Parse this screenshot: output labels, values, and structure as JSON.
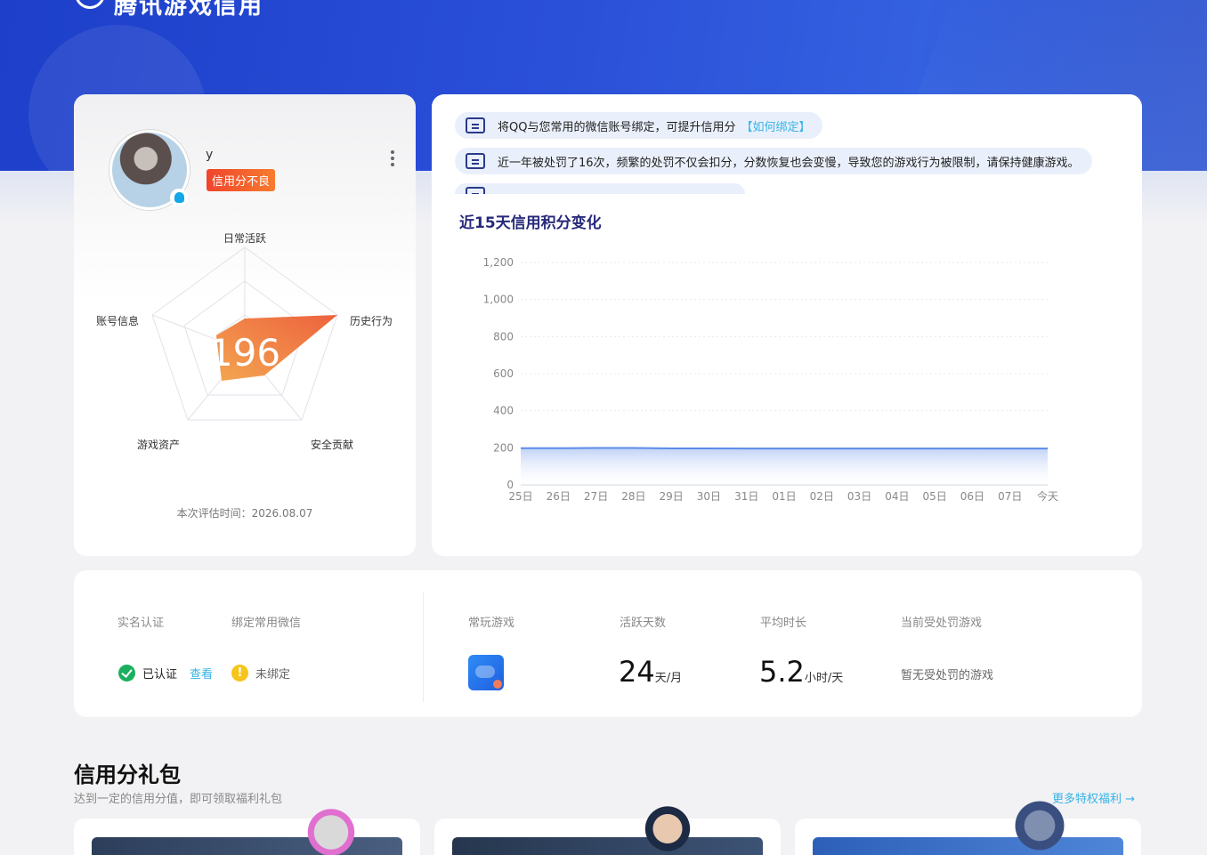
{
  "header": {
    "title": "腾讯游戏信用"
  },
  "profile": {
    "username": "y",
    "credit_status": "信用分不良",
    "score": "196",
    "radar_labels": [
      "日常活跃",
      "历史行为",
      "安全贡献",
      "游戏资产",
      "账号信息"
    ],
    "eval_time": "本次评估时间：2026.08.07"
  },
  "notices": [
    {
      "text": "将QQ与您常用的微信账号绑定，可提升信用分",
      "link": "【如何绑定】"
    },
    {
      "text": "近一年被处罚了16次，频繁的处罚不仅会扣分，分数恢复也会变慢，导致您的游戏行为被限制，请保持健康游戏。",
      "link": ""
    }
  ],
  "chart_title": "近15天信用积分变化",
  "chart_data": {
    "type": "area",
    "title": "近15天信用积分变化",
    "categories": [
      "25日",
      "26日",
      "27日",
      "28日",
      "29日",
      "30日",
      "31日",
      "01日",
      "02日",
      "03日",
      "04日",
      "05日",
      "06日",
      "07日",
      "今天"
    ],
    "series": [
      {
        "values": [
          198,
          198,
          199,
          199,
          197,
          197,
          196,
          196,
          196,
          196,
          196,
          196,
          196,
          196,
          196
        ]
      }
    ],
    "yticks": [
      "0",
      "200",
      "400",
      "600",
      "800",
      "1,000",
      "1,200"
    ],
    "ylim": [
      0,
      1200
    ],
    "grid": true,
    "line_color": "#5b8be8"
  },
  "stats": {
    "realname_label": "实名认证",
    "wechat_label": "绑定常用微信",
    "realname_status": "已认证",
    "realname_view": "查看",
    "wechat_status": "未绑定",
    "warn_glyph": "!",
    "games_label": "常玩游戏",
    "active_days_label": "活跃天数",
    "active_days_value": "24",
    "active_days_unit": "天/月",
    "avg_time_label": "平均时长",
    "avg_time_value": "5.2",
    "avg_time_unit": "小时/天",
    "punish_label": "当前受处罚游戏",
    "punish_value": "暂无受处罚的游戏"
  },
  "gift": {
    "title": "信用分礼包",
    "subtitle": "达到一定的信用分值，即可领取福利礼包",
    "more": "更多特权福利 →"
  },
  "colors": {
    "accent": "#36b3e6",
    "hero": "#2a4fd8",
    "badge": "#f0442c"
  }
}
